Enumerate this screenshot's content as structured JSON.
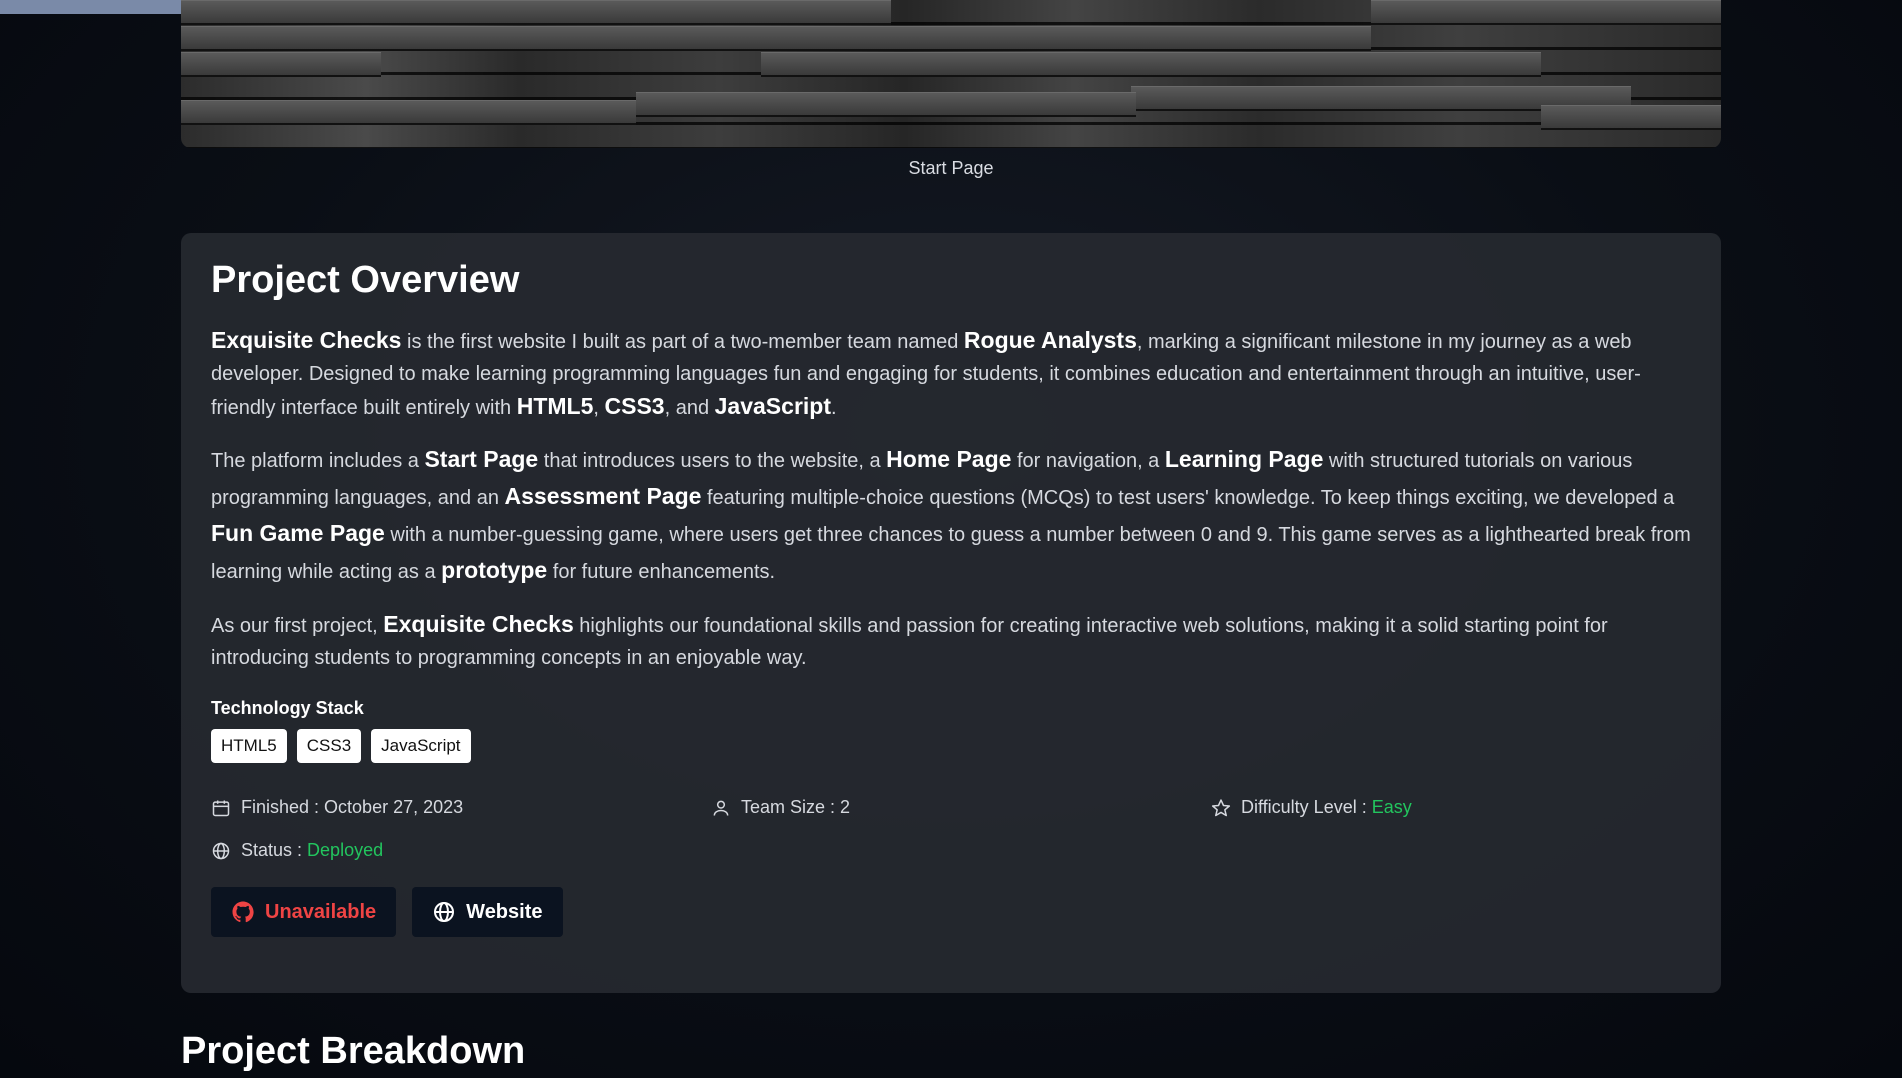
{
  "hero": {
    "caption": "Start Page"
  },
  "overview": {
    "title": "Project Overview",
    "p1": {
      "b1": "Exquisite Checks",
      "t1": " is the first website I built as part of a two-member team named ",
      "b2": "Rogue Analysts",
      "t2": ", marking a significant milestone in my journey as a web developer. Designed to make learning programming languages fun and engaging for students, it combines education and entertainment through an intuitive, user-friendly interface built entirely with ",
      "b3": "HTML5",
      "t3": ", ",
      "b4": "CSS3",
      "t4": ", and ",
      "b5": "JavaScript",
      "t5": "."
    },
    "p2": {
      "t1": "The platform includes a ",
      "b1": "Start Page",
      "t2": " that introduces users to the website, a ",
      "b2": "Home Page",
      "t3": " for navigation, a ",
      "b3": "Learning Page",
      "t4": " with structured tutorials on various programming languages, and an ",
      "b4": "Assessment Page",
      "t5": " featuring multiple-choice questions (MCQs) to test users' knowledge. To keep things exciting, we developed a ",
      "b5": "Fun Game Page",
      "t6": " with a number-guessing game, where users get three chances to guess a number between 0 and 9. This game serves as a lighthearted break from learning while acting as a ",
      "b6": "prototype",
      "t7": " for future enhancements."
    },
    "p3": {
      "t1": "As our first project, ",
      "b1": "Exquisite Checks",
      "t2": " highlights our foundational skills and passion for creating interactive web solutions, making it a solid starting point for introducing students to programming concepts in an enjoyable way."
    },
    "stack_title": "Technology Stack",
    "tags": [
      "HTML5",
      "CSS3",
      "JavaScript"
    ],
    "meta": {
      "finished_label": "Finished : ",
      "finished_value": "October 27, 2023",
      "team_label": "Team Size : ",
      "team_value": "2",
      "difficulty_label": "Difficulty Level : ",
      "difficulty_value": "Easy",
      "status_label": "Status : ",
      "status_value": "Deployed"
    },
    "buttons": {
      "github_label": "Unavailable",
      "website_label": "Website"
    },
    "icons": {
      "calendar": "calendar-icon",
      "user": "user-icon",
      "star": "star-icon",
      "globe": "globe-icon",
      "github": "github-icon"
    },
    "colors": {
      "accent_green": "#22c55e",
      "unavailable_red": "#ef4444"
    }
  },
  "breakdown": {
    "title": "Project Breakdown"
  }
}
